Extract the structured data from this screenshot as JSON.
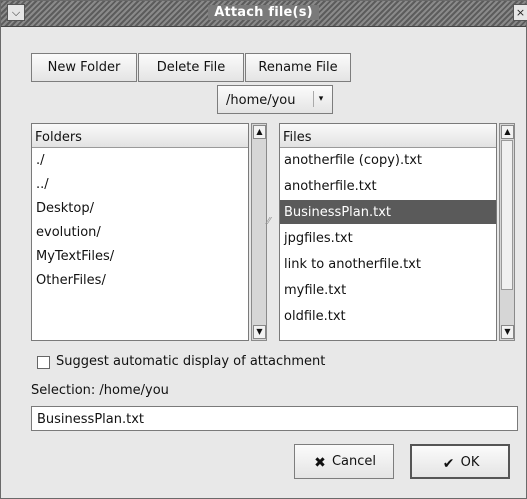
{
  "window": {
    "title": "Attach file(s)",
    "menu_icon": "chevron-down-icon",
    "close_icon": "close-icon"
  },
  "toolbar": {
    "new_folder": "New Folder",
    "delete_file": "Delete File",
    "rename_file": "Rename File"
  },
  "path_select": {
    "value": "/home/you"
  },
  "folders": {
    "header": "Folders",
    "items": [
      "./",
      "../",
      "Desktop/",
      "evolution/",
      "MyTextFiles/",
      "OtherFiles/"
    ]
  },
  "files": {
    "header": "Files",
    "items": [
      "anotherfile (copy).txt",
      "anotherfile.txt",
      "BusinessPlan.txt",
      "jpgfiles.txt",
      "link to anotherfile.txt",
      "myfile.txt",
      "oldfile.txt"
    ],
    "selected": "BusinessPlan.txt"
  },
  "options": {
    "suggest_display": "Suggest automatic display of attachment",
    "suggest_checked": false
  },
  "selection": {
    "label": "Selection: /home/you",
    "value": "BusinessPlan.txt"
  },
  "buttons": {
    "cancel": "Cancel",
    "ok": "OK"
  },
  "colors": {
    "selected_row_bg": "#5a5a5a",
    "selected_row_text": "#ffffff"
  }
}
